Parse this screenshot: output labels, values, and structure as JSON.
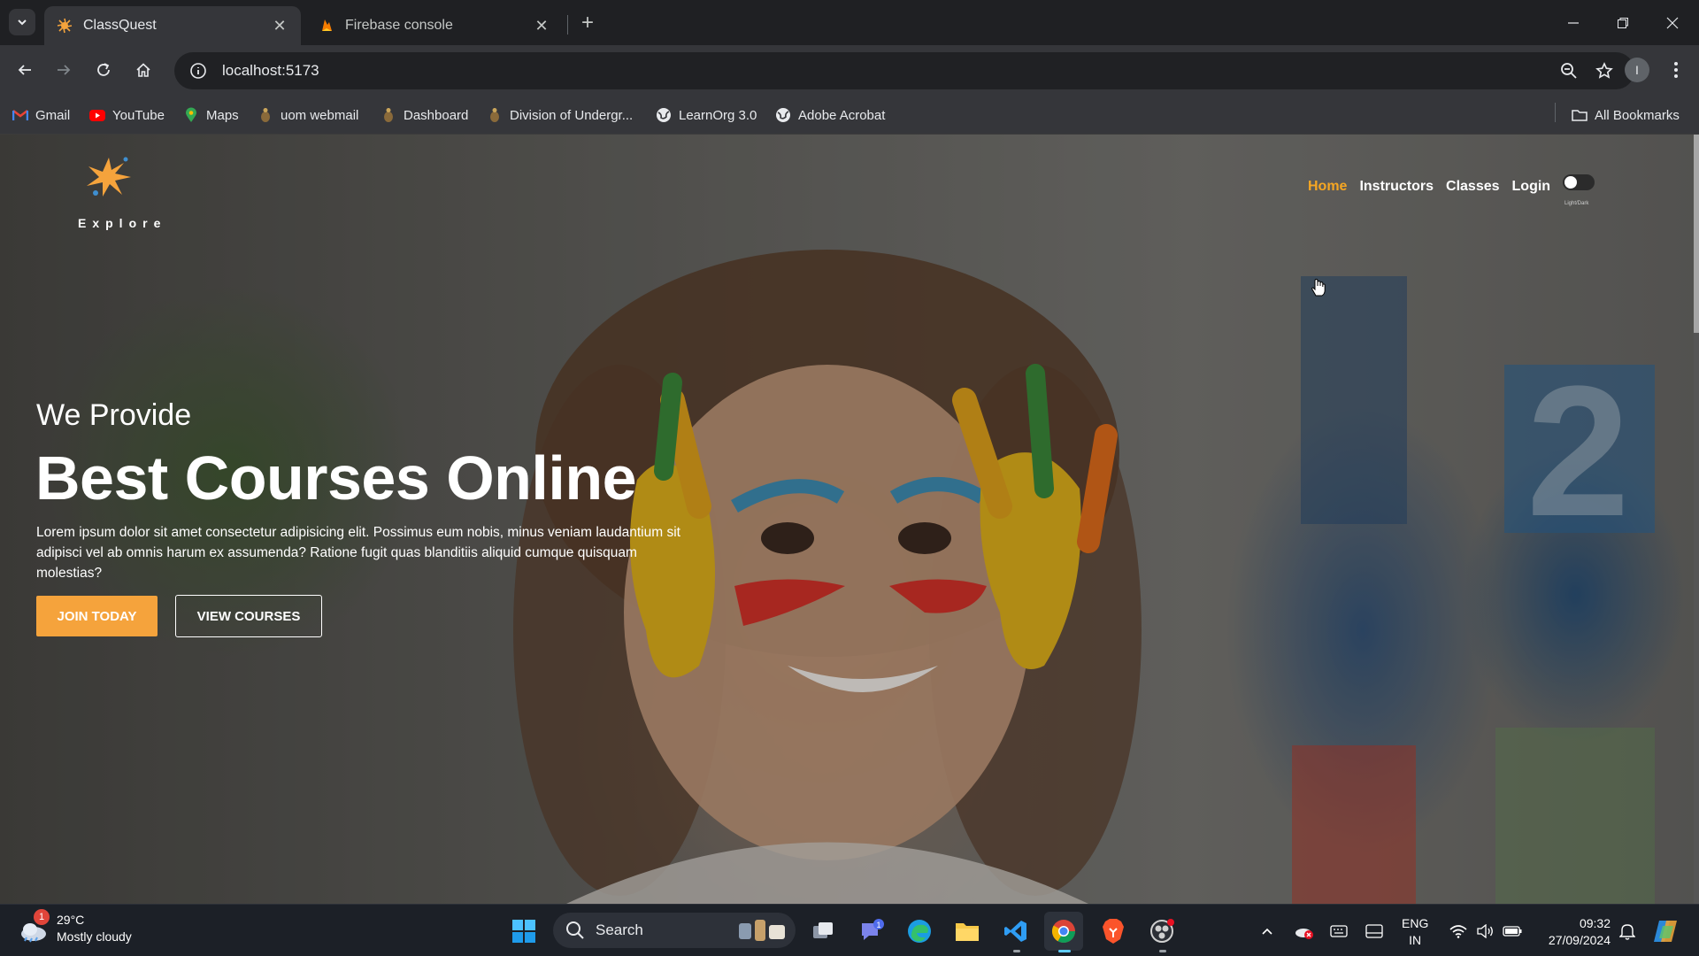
{
  "browser": {
    "tabs": [
      {
        "title": "ClassQuest",
        "active": true
      },
      {
        "title": "Firebase console",
        "active": false
      }
    ],
    "url": "localhost:5173",
    "profile_initial": "I",
    "bookmarks": [
      "Gmail",
      "YouTube",
      "Maps",
      "uom webmail",
      "Dashboard",
      "Division of Undergr...",
      "LearnOrg 3.0",
      "Adobe Acrobat"
    ],
    "all_bookmarks_label": "All Bookmarks"
  },
  "site": {
    "logo_text": "Explore",
    "nav": [
      "Home",
      "Instructors",
      "Classes",
      "Login"
    ],
    "theme_toggle_label": "Light/Dark",
    "hero": {
      "subtitle": "We Provide",
      "title": "Best Courses Online",
      "description": "Lorem ipsum dolor sit amet consectetur adipisicing elit. Possimus eum nobis, minus veniam laudantium sit adipisci vel ab omnis harum ex assumenda? Ratione fugit quas blanditiis aliquid cumque quisquam molestias?",
      "join_button": "JOIN TODAY",
      "view_button": "VIEW COURSES"
    },
    "accent_color": "#f5a33c"
  },
  "taskbar": {
    "weather": {
      "temp": "29°C",
      "condition": "Mostly cloudy",
      "badge": "1"
    },
    "search_label": "Search",
    "teams_badge": "1",
    "lang_line1": "ENG",
    "lang_line2": "IN",
    "time": "09:32",
    "date": "27/09/2024"
  }
}
